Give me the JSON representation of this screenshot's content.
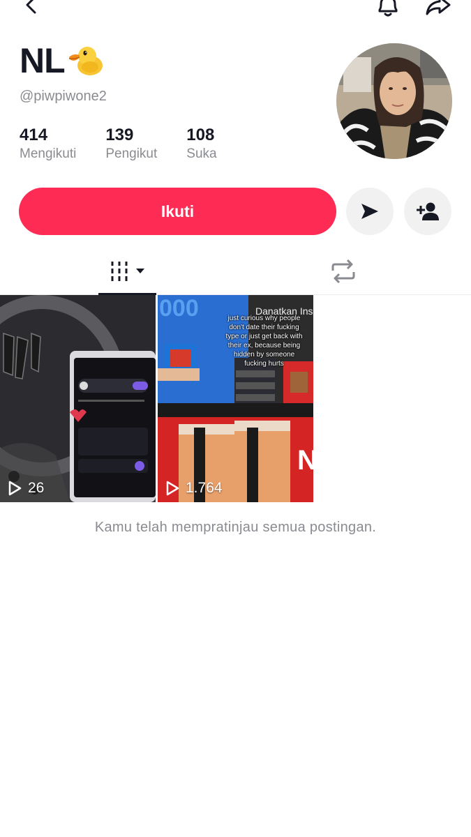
{
  "profile": {
    "display_name": "NL",
    "emoji": "duck-emoji",
    "username": "@piwpiwone2",
    "stats": [
      {
        "value": "414",
        "label": "Mengikuti"
      },
      {
        "value": "139",
        "label": "Pengikut"
      },
      {
        "value": "108",
        "label": "Suka"
      }
    ]
  },
  "actions": {
    "follow_label": "Ikuti"
  },
  "tabs": {
    "videos_icon": "videos-grid-icon",
    "reposts_icon": "repost-icon"
  },
  "videos": [
    {
      "views": "26"
    },
    {
      "views": "1.764",
      "overlay_text": "just curious why people don't date their fucking type or just get back with their ex, because being hidden by someone fucking hurts"
    }
  ],
  "end_note": "Kamu telah mempratinjau semua postingan.",
  "colors": {
    "accent": "#fe2c55",
    "muted_text": "#8a8b91",
    "button_bg": "#f1f1f2"
  }
}
